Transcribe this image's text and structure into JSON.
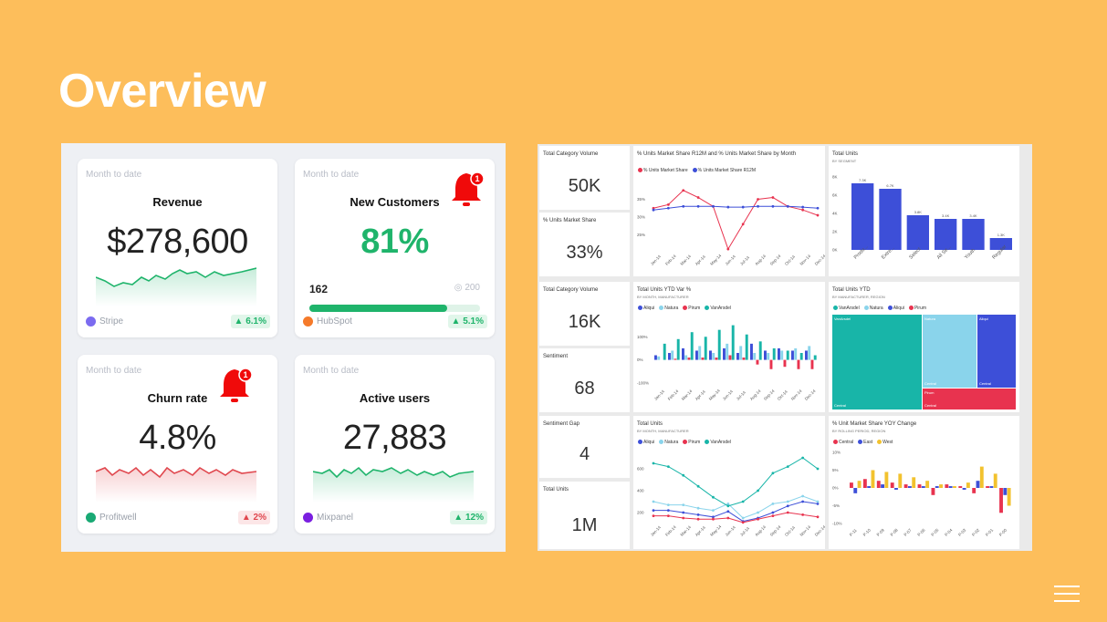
{
  "title": "Overview",
  "kpis": [
    {
      "sub": "Month to date",
      "name": "Revenue",
      "value": "$278,600",
      "source": "Stripe",
      "change": "▲ 6.1%"
    },
    {
      "sub": "Month to date",
      "name": "New Customers",
      "value": "81%",
      "progress_left": "162",
      "progress_right": "200",
      "progress": 0.81,
      "source": "HubSpot",
      "change": "▲ 5.1%",
      "bell_count": "1"
    },
    {
      "sub": "Month to date",
      "name": "Churn rate",
      "value": "4.8%",
      "source": "Profitwell",
      "change": "▲ 2%",
      "bell_count": "1"
    },
    {
      "sub": "Month to date",
      "name": "Active users",
      "value": "27,883",
      "source": "Mixpanel",
      "change": "▲ 12%"
    }
  ],
  "colors": {
    "green": "#1FB46B",
    "red": "#E0474E",
    "bg": "#FDBE5B"
  },
  "bi": {
    "kpi_tiles": [
      {
        "label": "Total Category Volume",
        "value": "50K"
      },
      {
        "label": "% Units Market Share",
        "value": "33%"
      },
      {
        "label": "Total Category Volume",
        "value": "16K"
      },
      {
        "label": "Sentiment",
        "value": "68"
      },
      {
        "label": "Sentiment Gap",
        "value": "4"
      },
      {
        "label": "Total Units",
        "value": "1M"
      }
    ],
    "line1": {
      "title": "% Units Market Share R12M and % Units Market Share by Month",
      "legend": [
        "% Units Market Share",
        "% Units Market Share R12M"
      ]
    },
    "bar1": {
      "title": "Total Units",
      "subtitle": "BY SEGMENT"
    },
    "col1": {
      "title": "Total Units YTD Var %",
      "subtitle": "BY MONTH, MANUFACTURER",
      "legend": [
        "Aliqui",
        "Natura",
        "Pirum",
        "VanArsdel"
      ]
    },
    "tree": {
      "title": "Total Units YTD",
      "subtitle": "BY MANUFACTURER, REGION",
      "legend": [
        "VanArsdel",
        "Natura",
        "Aliqui",
        "Pirum"
      ],
      "labels": [
        "VanArsdel",
        "Natura",
        "Aliqui",
        "Central",
        "Central",
        "Central",
        "Pirum",
        "Central"
      ]
    },
    "line2": {
      "title": "Total Units",
      "subtitle": "BY MONTH, MANUFACTURER",
      "legend": [
        "Aliqui",
        "Natura",
        "Pirum",
        "VanArsdel"
      ]
    },
    "col2": {
      "title": "% Unit Market Share YOY Change",
      "subtitle": "BY ROLLING PERIOD, REGION",
      "legend": [
        "Central",
        "East",
        "West"
      ]
    }
  },
  "chart_data": [
    {
      "type": "line",
      "title": "% Units Market Share R12M and % Units Market Share by Month",
      "categories": [
        "Jan-14",
        "Feb-14",
        "Mar-14",
        "Apr-14",
        "May-14",
        "Jun-14",
        "Jul-14",
        "Aug-14",
        "Sep-14",
        "Oct-14",
        "Nov-14",
        "Dec-14"
      ],
      "ylim": [
        20,
        40
      ],
      "ticks": [
        "35%",
        "30%",
        "25%"
      ],
      "series": [
        {
          "name": "% Units Market Share",
          "color": "#E8334F",
          "values": [
            32.5,
            33.5,
            37.5,
            35.5,
            33,
            21,
            28,
            35,
            35.5,
            33,
            32,
            30.5
          ]
        },
        {
          "name": "% Units Market Share R12M",
          "color": "#3D4FD8",
          "values": [
            32,
            32.5,
            33,
            33,
            33,
            32.8,
            32.8,
            33,
            33,
            33,
            32.8,
            32.5
          ]
        }
      ]
    },
    {
      "type": "bar",
      "title": "Total Units",
      "categories": [
        "Produ...",
        "Extre...",
        "Select",
        "All Se...",
        "Youth",
        "Regular"
      ],
      "values": [
        7.3,
        6.7,
        3.8,
        3.4,
        3.4,
        1.3
      ],
      "labels": [
        "7.3K",
        "6.7K",
        "3.8K",
        "3.4K",
        "3.4K",
        "1.3K"
      ],
      "ticks": [
        "8K",
        "6K",
        "4K",
        "2K",
        "0K"
      ],
      "ylim": [
        0,
        8
      ]
    },
    {
      "type": "bar",
      "title": "Total Units YTD Var %",
      "categories": [
        "Jan-14",
        "Feb-14",
        "Mar-14",
        "Apr-14",
        "May-14",
        "Jun-14",
        "Jul-14",
        "Aug-14",
        "Sep-14",
        "Oct-14",
        "Nov-14",
        "Dec-14"
      ],
      "ticks": [
        "100%",
        "0%",
        "-100%"
      ],
      "ylim": [
        -120,
        180
      ],
      "series": [
        {
          "name": "Aliqui",
          "color": "#3D4FD8",
          "values": [
            20,
            30,
            50,
            40,
            40,
            50,
            30,
            70,
            40,
            50,
            40,
            40
          ]
        },
        {
          "name": "Natura",
          "color": "#8AD4EB",
          "values": [
            15,
            40,
            20,
            60,
            30,
            70,
            60,
            30,
            30,
            40,
            50,
            60
          ]
        },
        {
          "name": "Pirum",
          "color": "#E8334F",
          "values": [
            0,
            5,
            10,
            10,
            10,
            20,
            10,
            -20,
            -40,
            -30,
            -40,
            -40
          ]
        },
        {
          "name": "VanArsdel",
          "color": "#18B5A8",
          "values": [
            70,
            90,
            120,
            100,
            130,
            150,
            110,
            80,
            50,
            40,
            30,
            20
          ]
        }
      ]
    },
    {
      "type": "line",
      "title": "Total Units",
      "categories": [
        "Jan-14",
        "Feb-14",
        "Mar-14",
        "Apr-14",
        "May-14",
        "Jun-14",
        "Jul-14",
        "Aug-14",
        "Sep-14",
        "Oct-14",
        "Nov-14",
        "Dec-14"
      ],
      "ticks": [
        "600",
        "400",
        "200"
      ],
      "ylim": [
        100,
        750
      ],
      "series": [
        {
          "name": "Aliqui",
          "color": "#3D4FD8",
          "values": [
            220,
            220,
            200,
            180,
            160,
            210,
            120,
            150,
            200,
            260,
            300,
            280
          ]
        },
        {
          "name": "Natura",
          "color": "#8AD4EB",
          "values": [
            300,
            270,
            270,
            240,
            220,
            280,
            150,
            200,
            280,
            300,
            350,
            300
          ]
        },
        {
          "name": "Pirum",
          "color": "#E8334F",
          "values": [
            170,
            170,
            150,
            140,
            140,
            150,
            110,
            140,
            170,
            200,
            180,
            160
          ]
        },
        {
          "name": "VanArsdel",
          "color": "#18B5A8",
          "values": [
            650,
            620,
            540,
            440,
            340,
            260,
            300,
            400,
            560,
            620,
            700,
            600
          ]
        }
      ]
    },
    {
      "type": "bar",
      "title": "% Unit Market Share YOY Change",
      "categories": [
        "P-11",
        "P-10",
        "P-09",
        "P-08",
        "P-07",
        "P-06",
        "P-05",
        "P-04",
        "P-03",
        "P-02",
        "P-01",
        "P-00"
      ],
      "ticks": [
        "10%",
        "5%",
        "0%",
        "-5%",
        "-10%"
      ],
      "ylim": [
        -10,
        10
      ],
      "series": [
        {
          "name": "Central",
          "color": "#E8334F",
          "values": [
            1.5,
            2.5,
            2,
            1.5,
            1,
            1,
            -2,
            1,
            0.5,
            -1.5,
            0.5,
            -7
          ]
        },
        {
          "name": "East",
          "color": "#3D4FD8",
          "values": [
            -1.5,
            0.5,
            1,
            -0.5,
            0.5,
            0.5,
            0.5,
            0.5,
            -0.5,
            2,
            0.5,
            -2
          ]
        },
        {
          "name": "West",
          "color": "#F2C22E",
          "values": [
            2,
            5,
            4.5,
            4,
            3,
            2,
            1,
            0.5,
            1.5,
            6,
            4,
            -5
          ]
        }
      ]
    }
  ]
}
